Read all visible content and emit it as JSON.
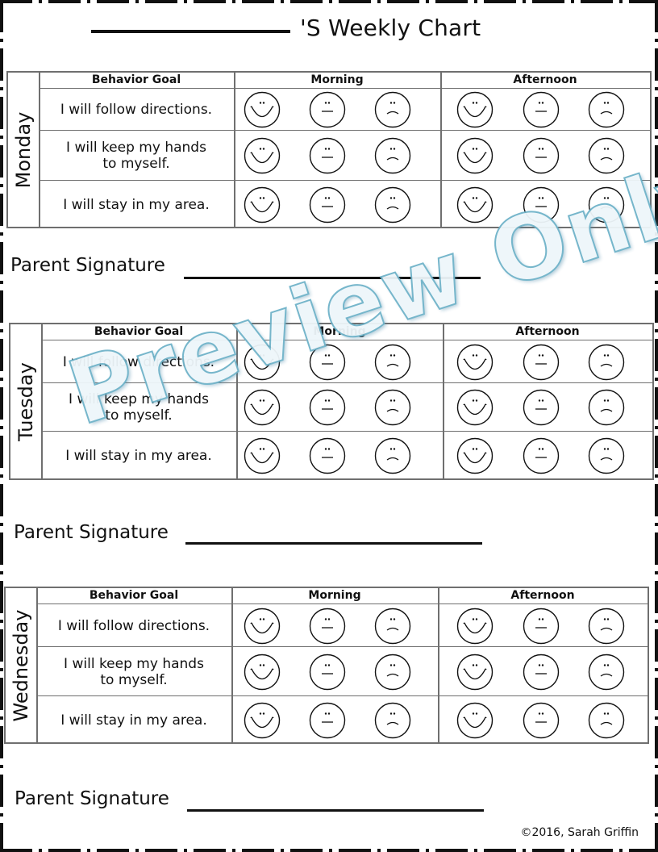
{
  "document": {
    "title_suffix": "'S Weekly Chart",
    "copyright": "©2016, Sarah Griffin",
    "watermark": "Preview Only",
    "watermark_colors": {
      "fill": "#eef6fa",
      "outline": "#6fb3c9"
    }
  },
  "table_headers": {
    "goal": "Behavior Goal",
    "morning": "Morning",
    "afternoon": "Afternoon"
  },
  "face_icons": [
    "happy-face",
    "neutral-face",
    "sad-face"
  ],
  "days": [
    {
      "name": "Monday",
      "goals": [
        "I will follow directions.",
        "I will keep my hands to myself.",
        "I will stay in my area."
      ],
      "signature_label": "Parent Signature"
    },
    {
      "name": "Tuesday",
      "goals": [
        "I will follow directions.",
        "I will keep my hands to myself.",
        "I will stay in my area."
      ],
      "signature_label": "Parent Signature"
    },
    {
      "name": "Wednesday",
      "goals": [
        "I will follow directions.",
        "I will keep my hands to myself.",
        "I will stay in my area."
      ],
      "signature_label": "Parent Signature"
    }
  ]
}
